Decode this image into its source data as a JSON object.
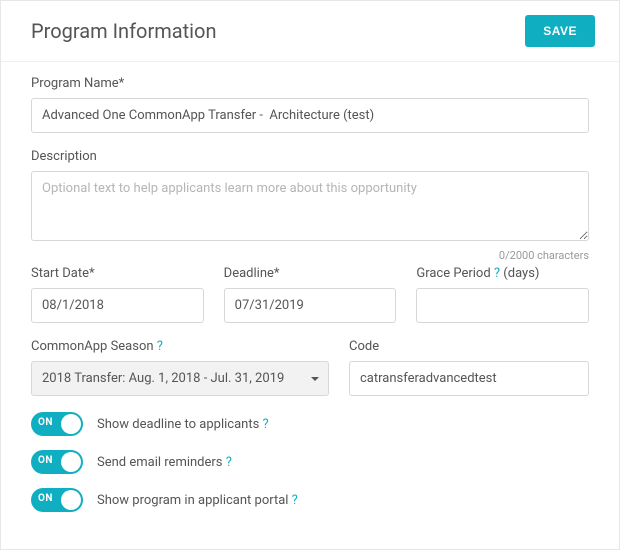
{
  "header": {
    "title": "Program Information",
    "save_label": "SAVE"
  },
  "fields": {
    "program_name_label": "Program Name*",
    "program_name_value": "Advanced One CommonApp Transfer -  Architecture (test)",
    "description_label": "Description",
    "description_placeholder": "Optional text to help applicants learn more about this opportunity",
    "char_count": "0/2000 characters",
    "start_date_label": "Start Date*",
    "start_date_value": "08/1/2018",
    "deadline_label": "Deadline*",
    "deadline_value": "07/31/2019",
    "grace_label": "Grace Period ",
    "grace_help": "?",
    "grace_suffix": " (days)",
    "grace_value": "",
    "season_label": "CommonApp Season ",
    "season_help": "?",
    "season_value": "2018 Transfer:  Aug. 1, 2018 - Jul. 31, 2019",
    "code_label": "Code",
    "code_value": "catransferadvancedtest"
  },
  "toggles": {
    "on_label": "ON",
    "show_deadline_label": "Show deadline to applicants ",
    "show_deadline_help": "?",
    "email_reminders_label": "Send email reminders ",
    "email_reminders_help": "?",
    "show_portal_label": "Show program in applicant portal ",
    "show_portal_help": "?"
  }
}
